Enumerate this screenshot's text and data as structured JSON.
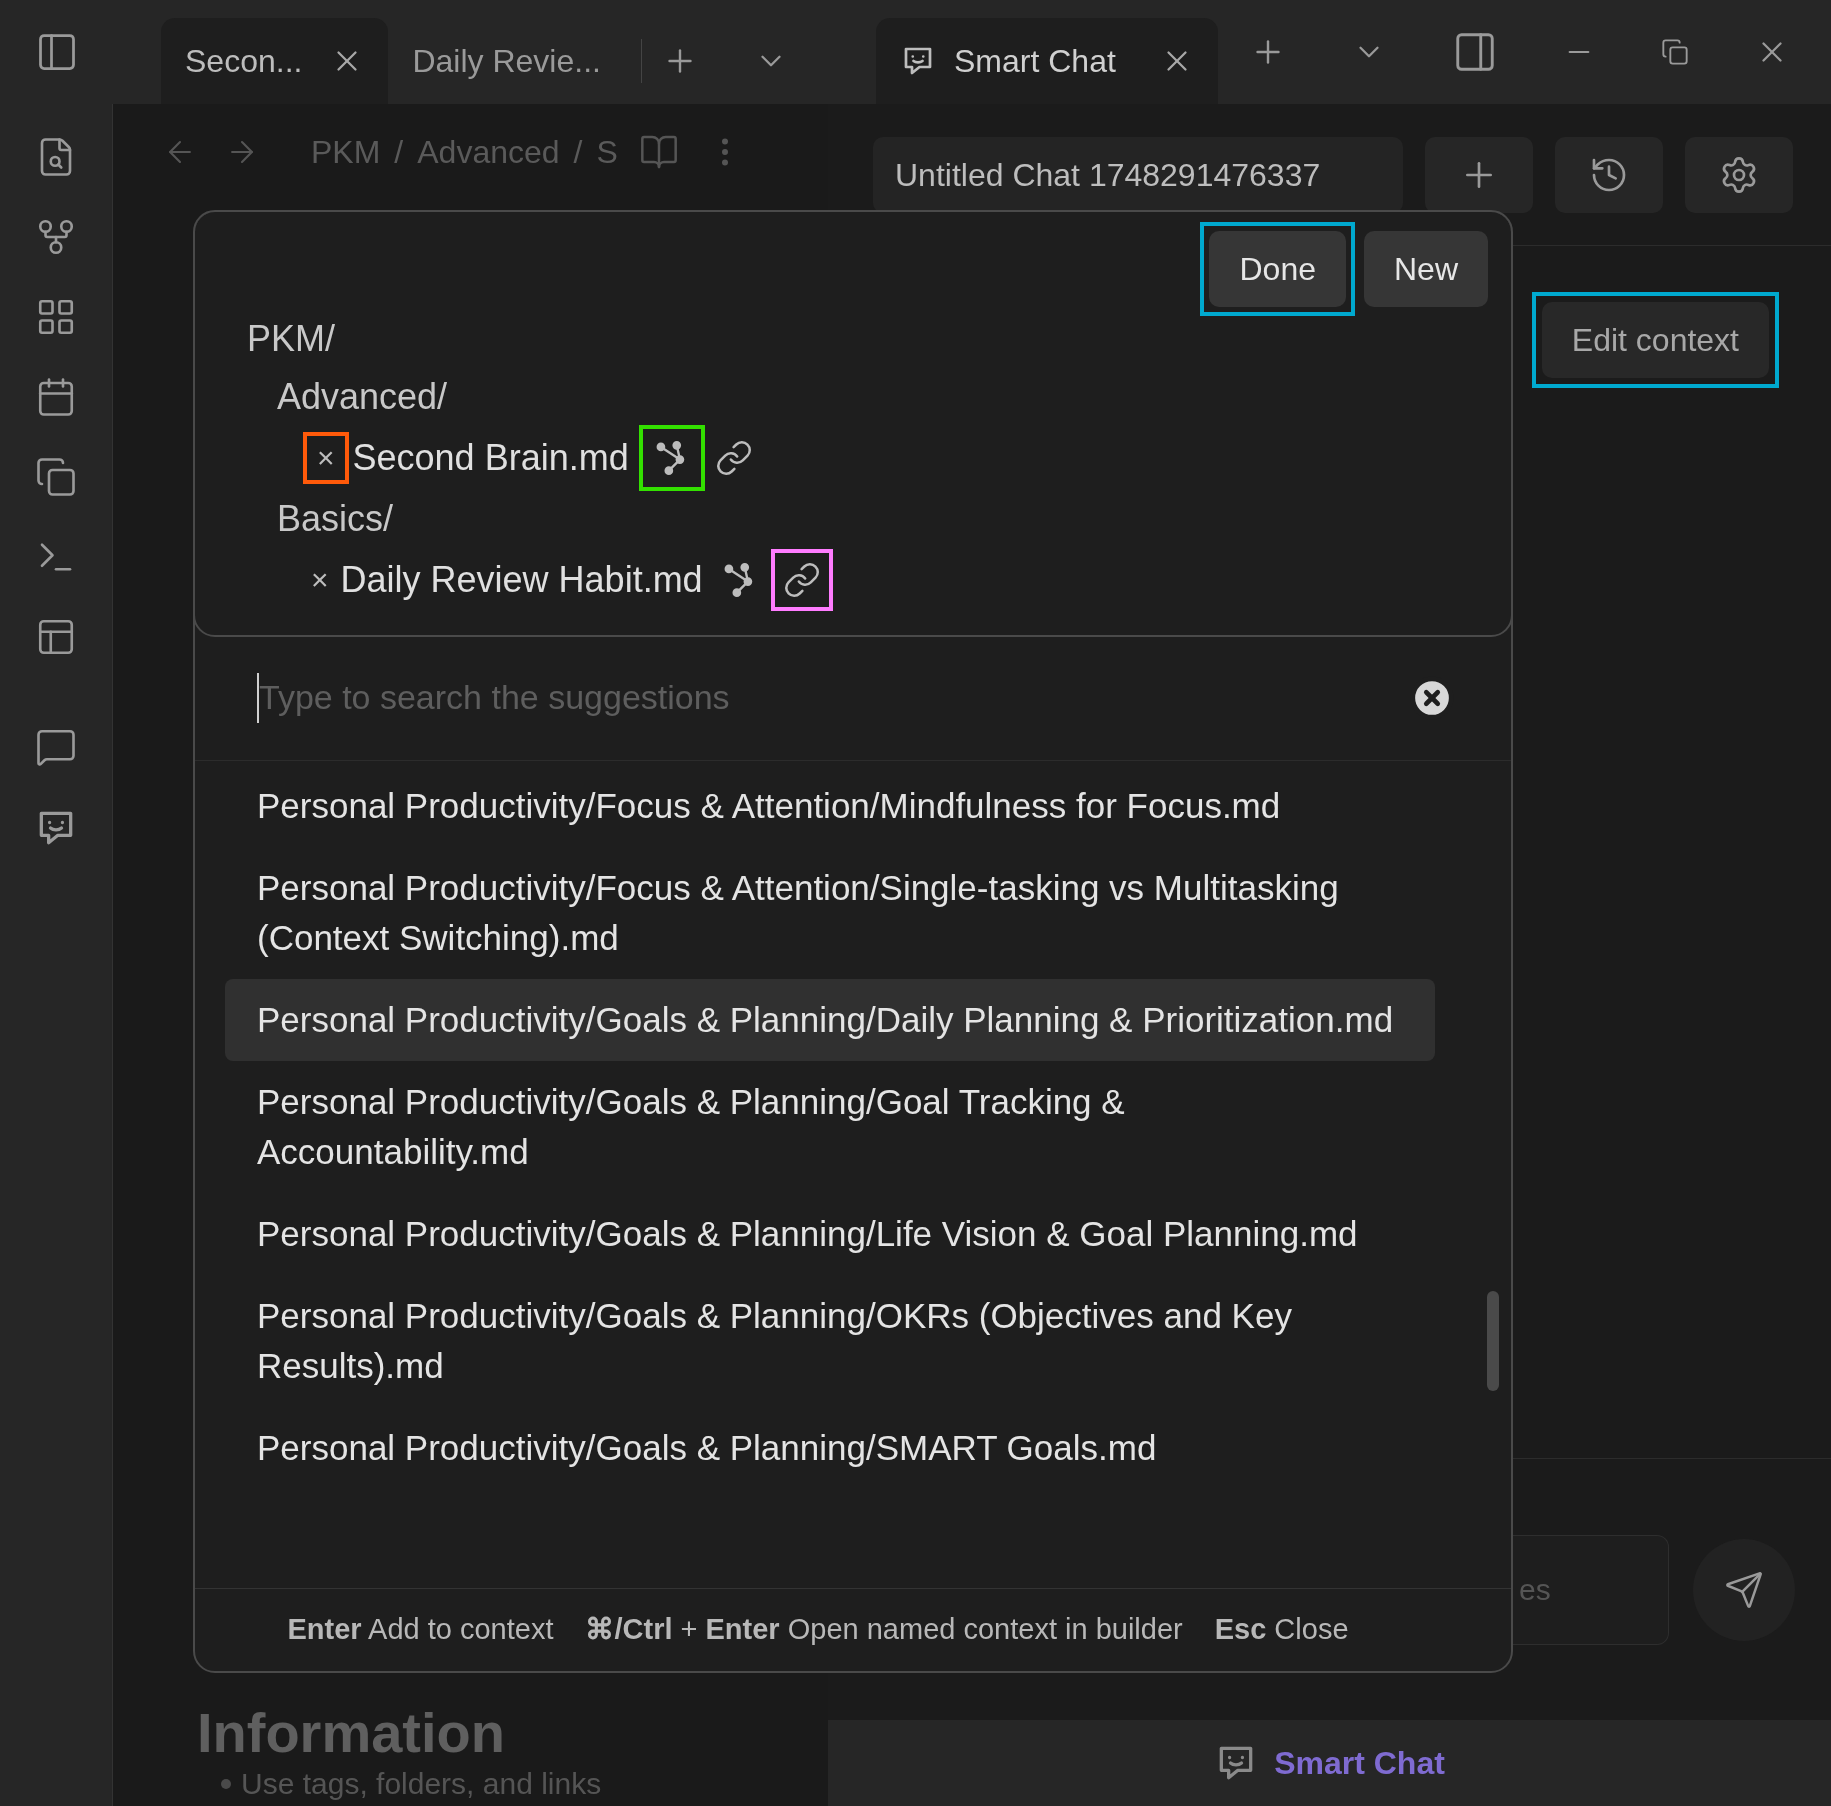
{
  "left_tabs": [
    {
      "label": "Secon...",
      "selected": true
    },
    {
      "label": "Daily Revie...",
      "selected": false
    }
  ],
  "right_tabs": [
    {
      "label": "Smart Chat",
      "selected": true
    }
  ],
  "breadcrumb": [
    "PKM",
    "/",
    "Advanced",
    "/",
    "S"
  ],
  "note": {
    "heading_lines": [
      "Information"
    ],
    "bullets": [
      "Use tags, folders, and links"
    ]
  },
  "chat": {
    "title": "Untitled Chat 1748291476337",
    "edit_context": {
      "label": "Edit context",
      "highlight": {
        "color": "#00a9cf"
      }
    },
    "input_visible_text": "es",
    "footer_label": "Smart Chat"
  },
  "context_modal": {
    "buttons": [
      {
        "label": "Done",
        "highlight": {
          "color": "#00a9cf"
        }
      },
      {
        "label": "New"
      }
    ],
    "tree": [
      {
        "label": "PKM/",
        "children": [
          {
            "label": "Advanced/",
            "children": [
              {
                "label": "Second Brain.md",
                "remove": "×",
                "remove_highlight": {
                  "color": "#ff5a0a"
                },
                "graph_highlight": {
                  "color": "#33e000"
                }
              }
            ]
          },
          {
            "label": "Basics/",
            "children": [
              {
                "label": "Daily Review Habit.md",
                "remove": "×",
                "link_highlight": {
                  "color": "#ff7cff"
                }
              }
            ]
          }
        ]
      }
    ],
    "search": {
      "placeholder": "Type to search the suggestions"
    },
    "suggestions": [
      {
        "text": "Personal Productivity/Focus & Attention/Mindfulness for Focus.md",
        "selected": false
      },
      {
        "text": "Personal Productivity/Focus & Attention/Single-tasking vs Multitasking (Context Switching).md",
        "selected": false
      },
      {
        "text": "Personal Productivity/Goals & Planning/Daily Planning & Prioritization.md",
        "selected": true
      },
      {
        "text": "Personal Productivity/Goals & Planning/Goal Tracking & Accountability.md",
        "selected": false
      },
      {
        "text": "Personal Productivity/Goals & Planning/Life Vision & Goal Planning.md",
        "selected": false
      },
      {
        "text": "Personal Productivity/Goals & Planning/OKRs (Objectives and Key Results).md",
        "selected": false
      },
      {
        "text": "Personal Productivity/Goals & Planning/SMART Goals.md",
        "selected": false
      }
    ],
    "hints": [
      "**Enter** Add to context",
      "**⌘/Ctrl** + **Enter** Open named context in builder",
      "**Esc** Close"
    ]
  }
}
